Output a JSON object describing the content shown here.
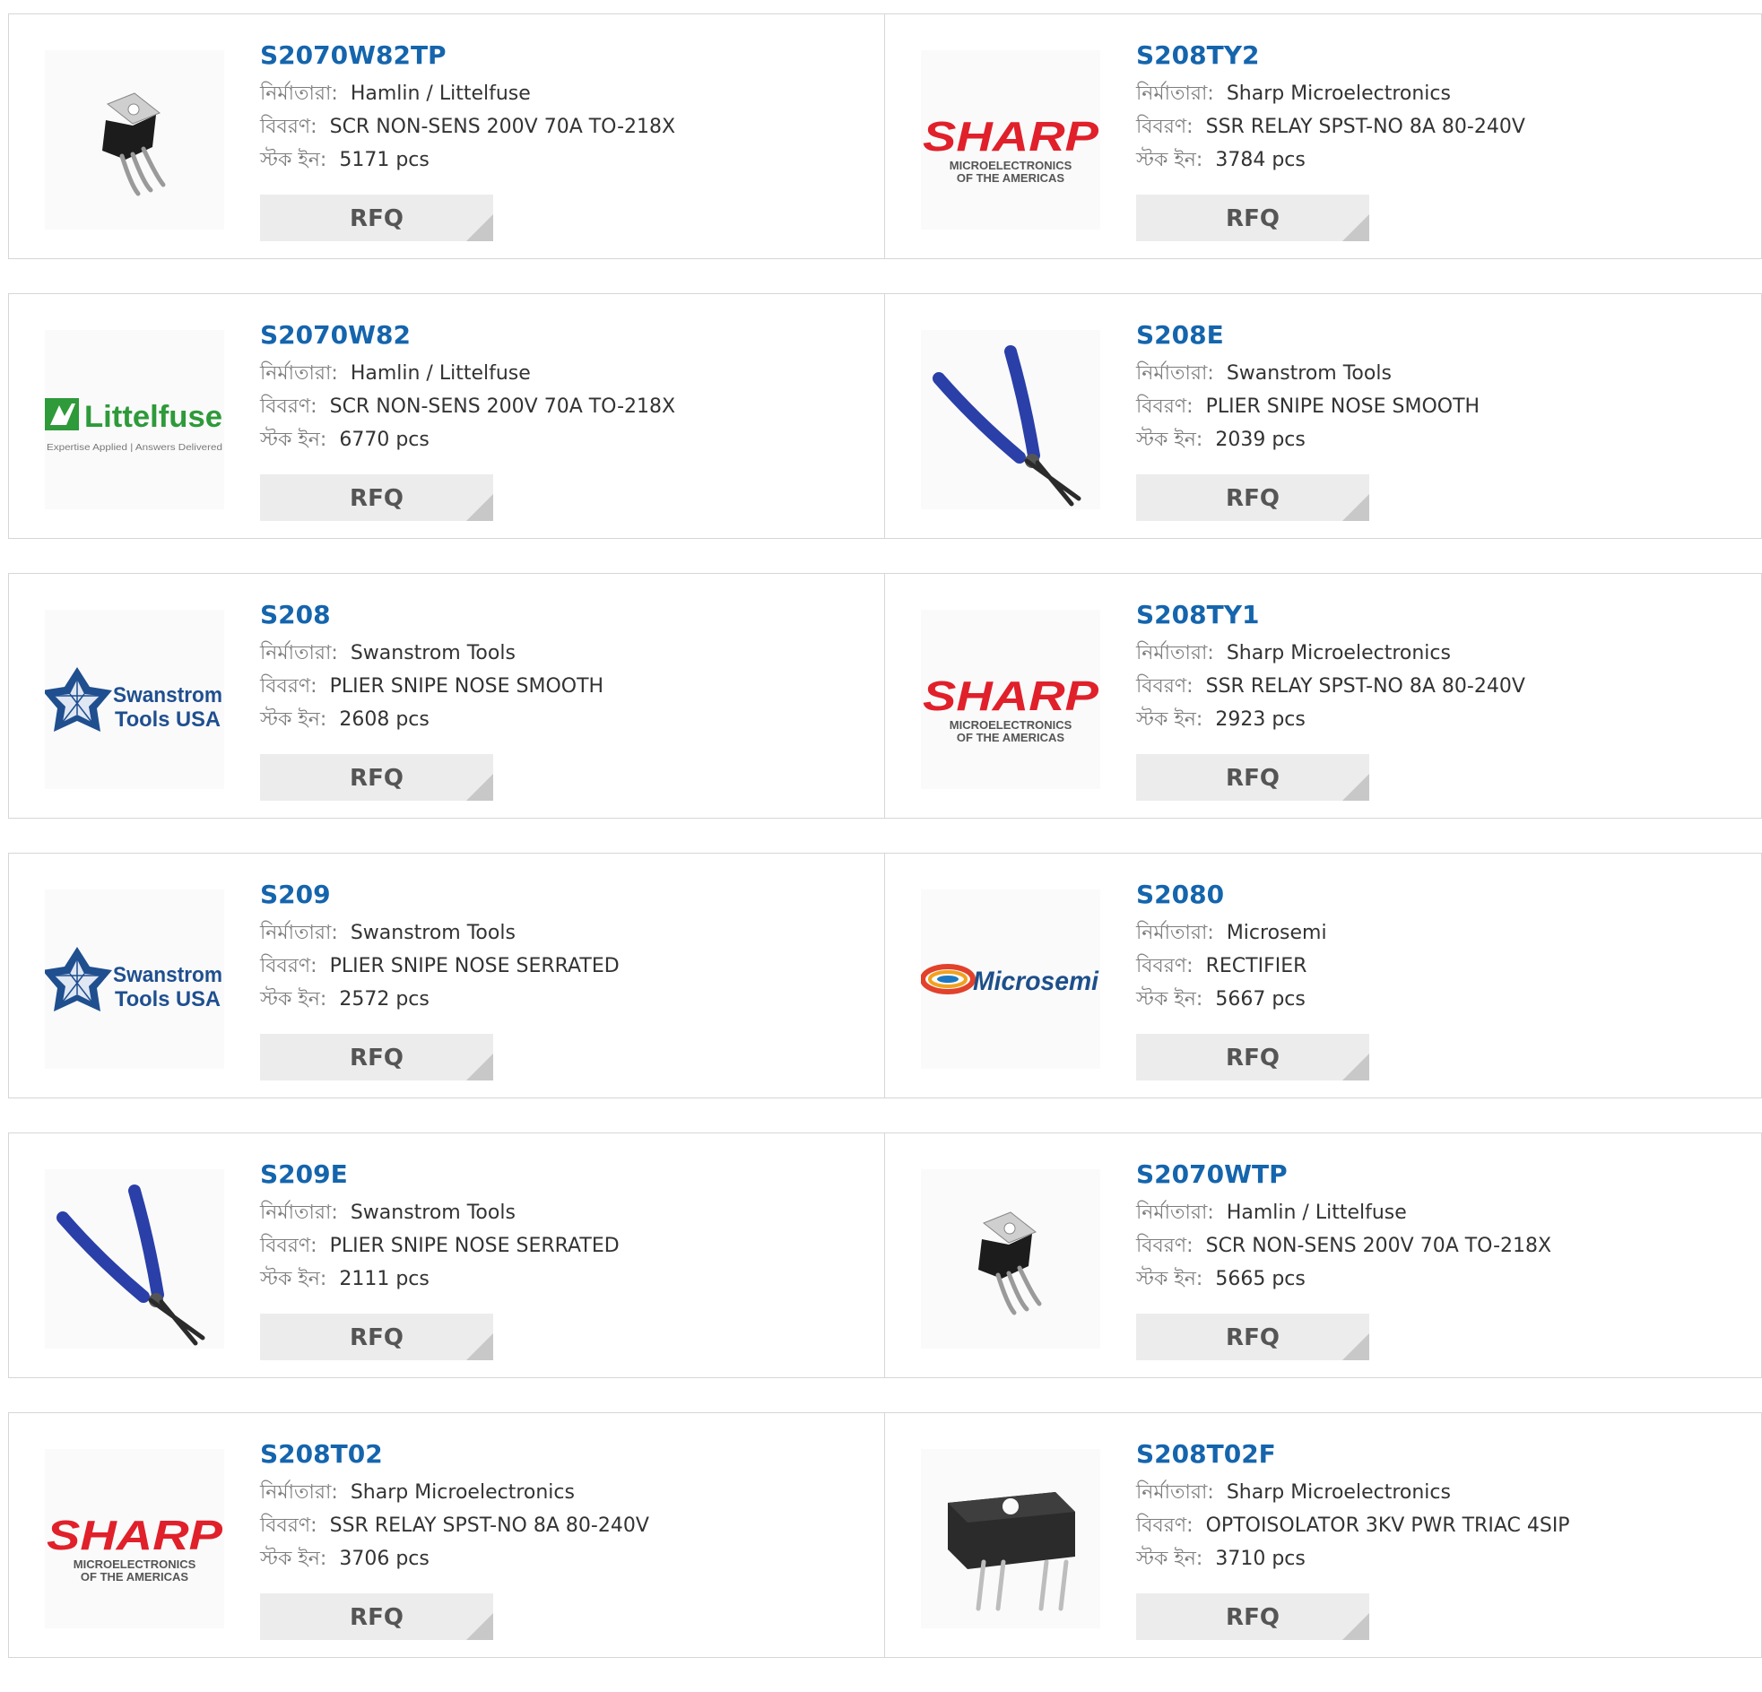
{
  "labels": {
    "manufacturer": "নির্মাতারা:",
    "description": "বিবরণ:",
    "stock": "স্টক ইন:",
    "rfq": "RFQ"
  },
  "brand_text": {
    "sharp": "SHARP",
    "sharp_sub1": "MICROELECTRONICS",
    "sharp_sub2": "OF THE AMERICAS",
    "littelfuse": "Littelfuse",
    "littelfuse_tag": "Expertise Applied | Answers Delivered",
    "swanstrom1": "Swanstrom",
    "swanstrom2": "Tools USA",
    "microsemi": "Microsemi"
  },
  "colors": {
    "part_link": "#1565ad",
    "sharp_red": "#e0202a",
    "littelfuse_green": "#2e9a3a",
    "swanstrom_blue": "#1f4f8f",
    "plier_blue": "#2a3fa8"
  },
  "products": [
    {
      "part": "S2070W82TP",
      "manufacturer": "Hamlin / Littelfuse",
      "description": "SCR NON-SENS 200V 70A TO-218X",
      "stock": "5171 pcs",
      "image": "to218-package-icon"
    },
    {
      "part": "S208TY2",
      "manufacturer": "Sharp Microelectronics",
      "description": "SSR RELAY SPST-NO 8A 80-240V",
      "stock": "3784 pcs",
      "image": "sharp-logo"
    },
    {
      "part": "S2070W82",
      "manufacturer": "Hamlin / Littelfuse",
      "description": "SCR NON-SENS 200V 70A TO-218X",
      "stock": "6770 pcs",
      "image": "littelfuse-logo"
    },
    {
      "part": "S208E",
      "manufacturer": "Swanstrom Tools",
      "description": "PLIER SNIPE NOSE SMOOTH",
      "stock": "2039 pcs",
      "image": "plier-icon"
    },
    {
      "part": "S208",
      "manufacturer": "Swanstrom Tools",
      "description": "PLIER SNIPE NOSE SMOOTH",
      "stock": "2608 pcs",
      "image": "swanstrom-logo"
    },
    {
      "part": "S208TY1",
      "manufacturer": "Sharp Microelectronics",
      "description": "SSR RELAY SPST-NO 8A 80-240V",
      "stock": "2923 pcs",
      "image": "sharp-logo"
    },
    {
      "part": "S209",
      "manufacturer": "Swanstrom Tools",
      "description": "PLIER SNIPE NOSE SERRATED",
      "stock": "2572 pcs",
      "image": "swanstrom-logo"
    },
    {
      "part": "S2080",
      "manufacturer": "Microsemi",
      "description": "RECTIFIER",
      "stock": "5667 pcs",
      "image": "microsemi-logo"
    },
    {
      "part": "S209E",
      "manufacturer": "Swanstrom Tools",
      "description": "PLIER SNIPE NOSE SERRATED",
      "stock": "2111 pcs",
      "image": "plier-icon"
    },
    {
      "part": "S2070WTP",
      "manufacturer": "Hamlin / Littelfuse",
      "description": "SCR NON-SENS 200V 70A TO-218X",
      "stock": "5665 pcs",
      "image": "to218-package-icon"
    },
    {
      "part": "S208T02",
      "manufacturer": "Sharp Microelectronics",
      "description": "SSR RELAY SPST-NO 8A 80-240V",
      "stock": "3706 pcs",
      "image": "sharp-logo"
    },
    {
      "part": "S208T02F",
      "manufacturer": "Sharp Microelectronics",
      "description": "OPTOISOLATOR 3KV PWR TRIAC 4SIP",
      "stock": "3710 pcs",
      "image": "sip-package-icon"
    }
  ]
}
